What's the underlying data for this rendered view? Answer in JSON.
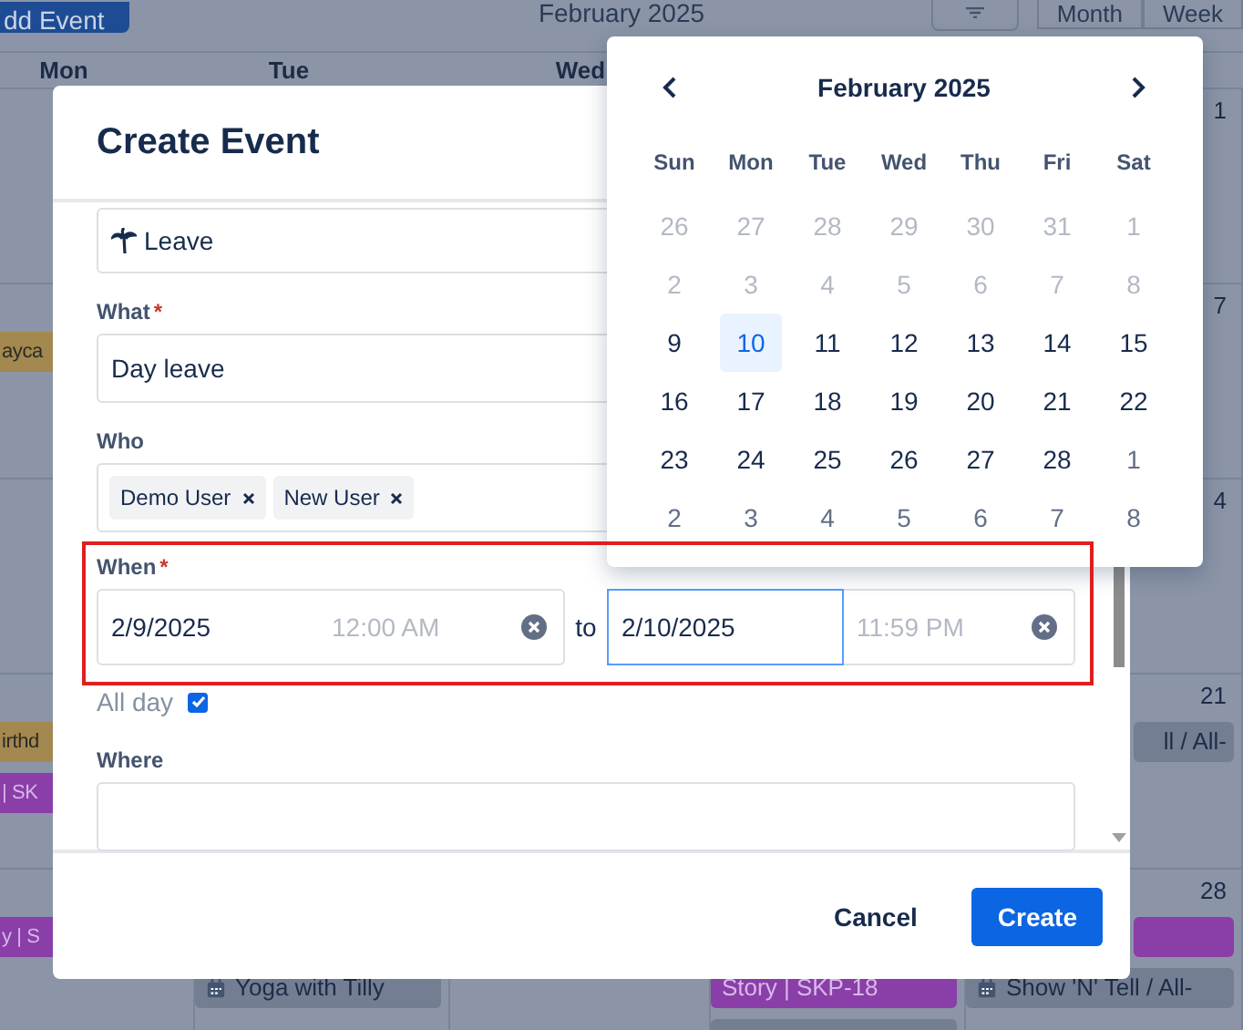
{
  "background_calendar": {
    "add_button": "dd Event",
    "title": "February 2025",
    "view_buttons": [
      "Month",
      "Week"
    ],
    "weekdays": [
      "Mon",
      "Tue",
      "Wed"
    ],
    "weeks": [
      {
        "fri": {
          "date": "1"
        }
      },
      {
        "mon": {
          "events": [
            {
              "kind": "bar",
              "label": "ayca",
              "color": "#a3884f"
            }
          ]
        },
        "fri": {
          "date": "7"
        }
      },
      {
        "fri": {
          "date": "4"
        }
      },
      {
        "mon": {
          "events": [
            {
              "kind": "bar",
              "label": "irthd",
              "color": "#a3884f"
            },
            {
              "kind": "bar",
              "label": "| SK",
              "color": "#8a3ea8"
            }
          ]
        },
        "fri": {
          "date": "21",
          "events": [
            {
              "kind": "tail",
              "label": "ll / All-",
              "color": "#737e93"
            }
          ]
        }
      },
      {
        "mon": {
          "events": [
            {
              "kind": "bar",
              "label": "y | S",
              "color": "#8a3ea8"
            }
          ]
        },
        "tue": {
          "events": [
            {
              "kind": "spacer"
            },
            {
              "kind": "item",
              "label": "Yoga with Tilly",
              "color": "#737e93"
            }
          ]
        },
        "thu": {
          "events": [
            {
              "kind": "spacer"
            },
            {
              "kind": "bar",
              "label": "Story | SKP-18",
              "color": "#8a3ea8"
            },
            {
              "kind": "stub",
              "color": "#737e93"
            }
          ]
        },
        "fri": {
          "date": "28",
          "events": [
            {
              "kind": "tail",
              "color": "#8a3ea8"
            },
            {
              "kind": "item",
              "label": "Show 'N' Tell / All-",
              "color": "#737e93"
            }
          ]
        }
      }
    ]
  },
  "dialog": {
    "title": "Create Event",
    "type_select": {
      "value": "Leave"
    },
    "what": {
      "label": "What",
      "required_mark": "*",
      "value": "Day leave"
    },
    "who": {
      "label": "Who",
      "tags": [
        "Demo User",
        "New User"
      ]
    },
    "when": {
      "label": "When",
      "required_mark": "*",
      "separator": "to",
      "start": {
        "date": "2/9/2025",
        "time": "12:00 AM",
        "time_disabled": true,
        "focused": false
      },
      "end": {
        "date": "2/10/2025",
        "time": "11:59 PM",
        "time_disabled": true,
        "focused": true
      }
    },
    "all_day": {
      "label": "All day",
      "checked": true
    },
    "where": {
      "label": "Where"
    },
    "buttons": [
      {
        "label": "Cancel",
        "kind": "secondary"
      },
      {
        "label": "Create",
        "kind": "primary"
      }
    ]
  },
  "date_picker": {
    "title": "February 2025",
    "weekdays": [
      "Sun",
      "Mon",
      "Tue",
      "Wed",
      "Thu",
      "Fri",
      "Sat"
    ],
    "weeks": [
      [
        {
          "day": "26",
          "kind": "disabled",
          "selected": false
        },
        {
          "day": "27",
          "kind": "disabled",
          "selected": false
        },
        {
          "day": "28",
          "kind": "disabled",
          "selected": false
        },
        {
          "day": "29",
          "kind": "disabled",
          "selected": false
        },
        {
          "day": "30",
          "kind": "disabled",
          "selected": false
        },
        {
          "day": "31",
          "kind": "disabled",
          "selected": false
        },
        {
          "day": "1",
          "kind": "disabled",
          "selected": false
        }
      ],
      [
        {
          "day": "2",
          "kind": "disabled",
          "selected": false
        },
        {
          "day": "3",
          "kind": "disabled",
          "selected": false
        },
        {
          "day": "4",
          "kind": "disabled",
          "selected": false
        },
        {
          "day": "5",
          "kind": "disabled",
          "selected": false
        },
        {
          "day": "6",
          "kind": "disabled",
          "selected": false
        },
        {
          "day": "7",
          "kind": "disabled",
          "selected": false
        },
        {
          "day": "8",
          "kind": "disabled",
          "selected": false
        }
      ],
      [
        {
          "day": "9",
          "kind": "current",
          "selected": false
        },
        {
          "day": "10",
          "kind": "current",
          "selected": true
        },
        {
          "day": "11",
          "kind": "current",
          "selected": false
        },
        {
          "day": "12",
          "kind": "current",
          "selected": false
        },
        {
          "day": "13",
          "kind": "current",
          "selected": false
        },
        {
          "day": "14",
          "kind": "current",
          "selected": false
        },
        {
          "day": "15",
          "kind": "current",
          "selected": false
        }
      ],
      [
        {
          "day": "16",
          "kind": "current",
          "selected": false
        },
        {
          "day": "17",
          "kind": "current",
          "selected": false
        },
        {
          "day": "18",
          "kind": "current",
          "selected": false
        },
        {
          "day": "19",
          "kind": "current",
          "selected": false
        },
        {
          "day": "20",
          "kind": "current",
          "selected": false
        },
        {
          "day": "21",
          "kind": "current",
          "selected": false
        },
        {
          "day": "22",
          "kind": "current",
          "selected": false
        }
      ],
      [
        {
          "day": "23",
          "kind": "current",
          "selected": false
        },
        {
          "day": "24",
          "kind": "current",
          "selected": false
        },
        {
          "day": "25",
          "kind": "current",
          "selected": false
        },
        {
          "day": "26",
          "kind": "current",
          "selected": false
        },
        {
          "day": "27",
          "kind": "current",
          "selected": false
        },
        {
          "day": "28",
          "kind": "current",
          "selected": false
        },
        {
          "day": "1",
          "kind": "outside",
          "selected": false
        }
      ],
      [
        {
          "day": "2",
          "kind": "outside",
          "selected": false
        },
        {
          "day": "3",
          "kind": "outside",
          "selected": false
        },
        {
          "day": "4",
          "kind": "outside",
          "selected": false
        },
        {
          "day": "5",
          "kind": "outside",
          "selected": false
        },
        {
          "day": "6",
          "kind": "outside",
          "selected": false
        },
        {
          "day": "7",
          "kind": "outside",
          "selected": false
        },
        {
          "day": "8",
          "kind": "outside",
          "selected": false
        }
      ]
    ]
  }
}
